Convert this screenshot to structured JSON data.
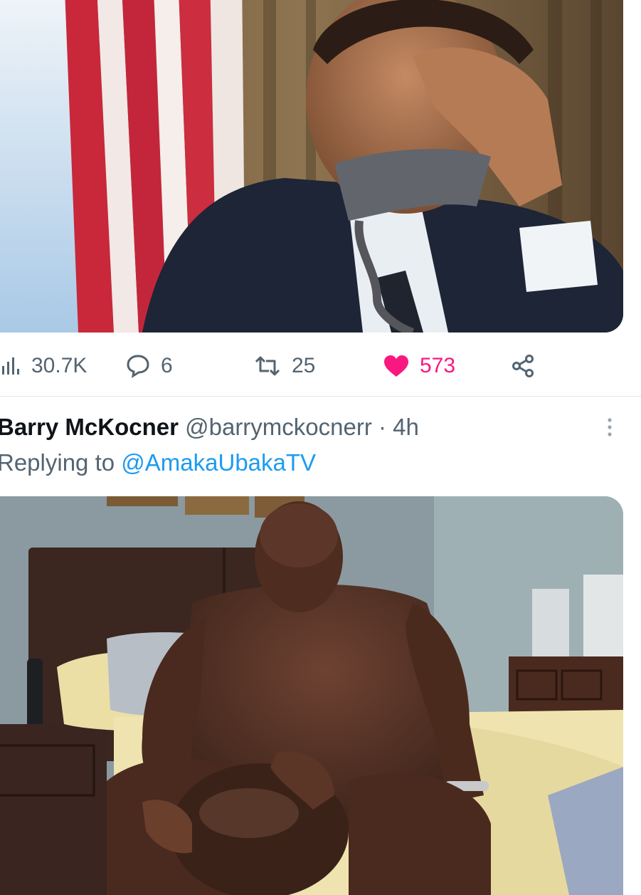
{
  "tweet_top": {
    "media": {
      "alt_subject": ""
    },
    "actions": {
      "views": {
        "icon": "views-chart-icon",
        "count": "30.7K"
      },
      "replies": {
        "icon": "reply-bubble-icon",
        "count": "6"
      },
      "retweets": {
        "icon": "retweet-icon",
        "count": "25"
      },
      "likes": {
        "icon": "heart-filled-icon",
        "count": "573",
        "liked": true,
        "color": "#f91880"
      },
      "share": {
        "icon": "share-icon"
      }
    }
  },
  "reply_tweet": {
    "display_name": "Barry McKocner",
    "handle": "@barrymckocnerr",
    "separator": "·",
    "time": "4h",
    "replying_prefix": "Replying to",
    "replying_to": "@AmakaUbakaTV",
    "more_icon": "more-vertical-icon"
  },
  "colors": {
    "text_primary": "#0f1419",
    "text_secondary": "#536471",
    "link": "#1d9bf0",
    "like": "#f91880"
  }
}
